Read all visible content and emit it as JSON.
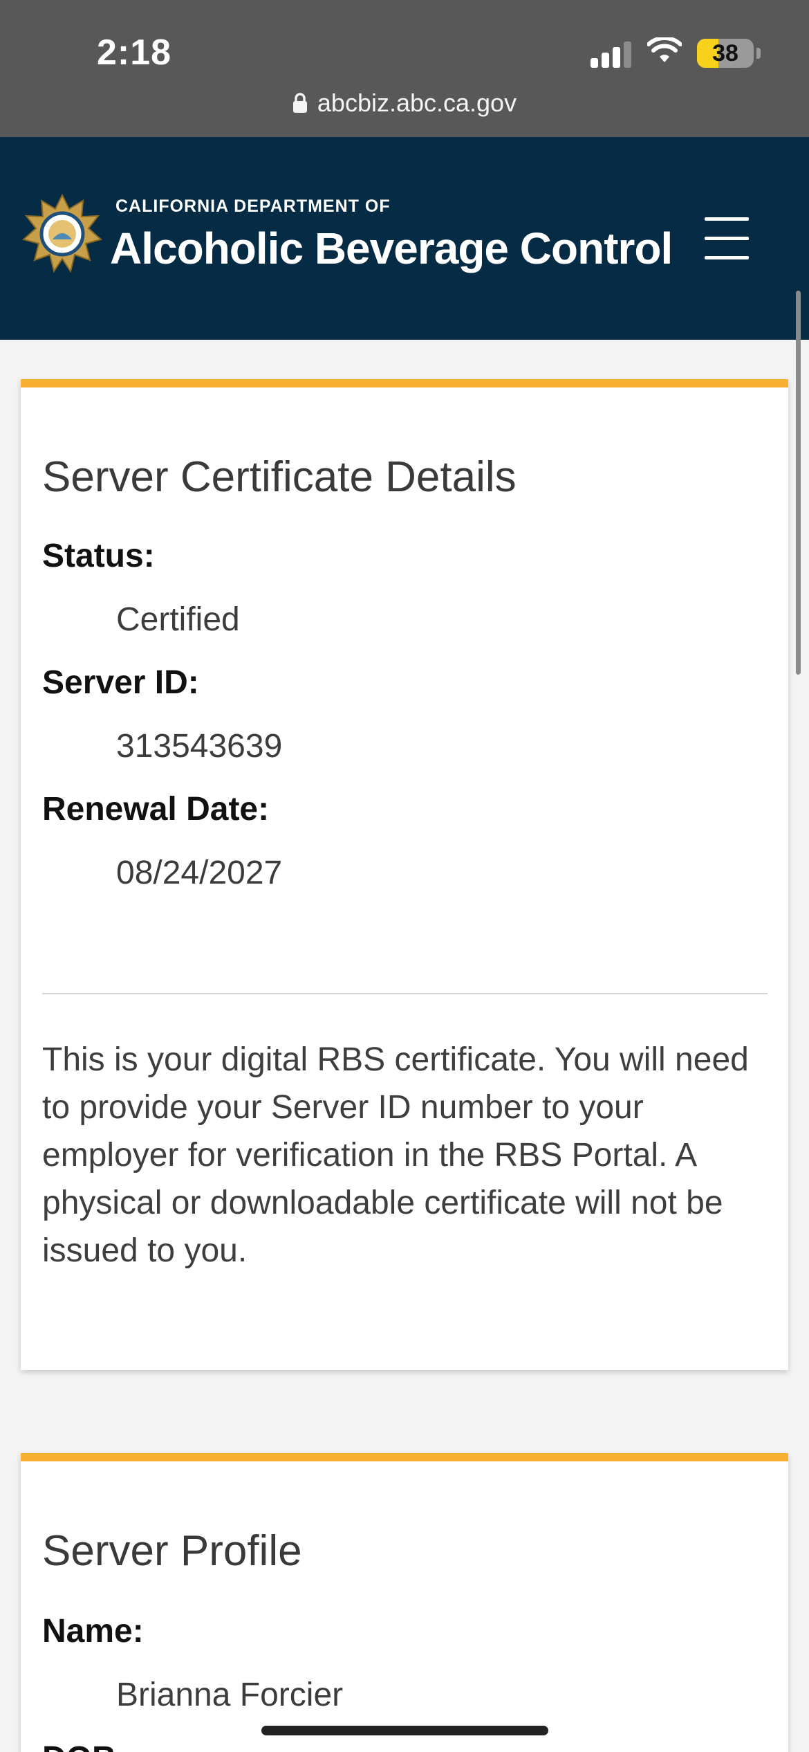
{
  "status_bar": {
    "time": "2:18",
    "battery_level": "38",
    "url": "abcbiz.abc.ca.gov"
  },
  "header": {
    "dept_line": "CALIFORNIA DEPARTMENT OF",
    "dept_name": "Alcoholic Beverage Control"
  },
  "certificate": {
    "title": "Server Certificate Details",
    "status_label": "Status:",
    "status_value": "Certified",
    "server_id_label": "Server ID:",
    "server_id_value": "313543639",
    "renewal_label": "Renewal Date:",
    "renewal_value": "08/24/2027",
    "notice": "This is your digital RBS certificate. You will need to provide your Server ID number to your employer for verification in the RBS Portal. A physical or downloadable certificate will not be issued to you."
  },
  "profile": {
    "title": "Server Profile",
    "name_label": "Name:",
    "name_value": "Brianna Forcier",
    "dob_label": "DOB:"
  },
  "colors": {
    "header_bg": "#052c44",
    "accent": "#f6af30",
    "status_bar_bg": "#585858",
    "battery_fill": "#f7d11b"
  },
  "icons": [
    "lock-icon",
    "signal-icon",
    "wifi-icon",
    "battery-icon",
    "seal-icon",
    "hamburger-menu-icon"
  ]
}
